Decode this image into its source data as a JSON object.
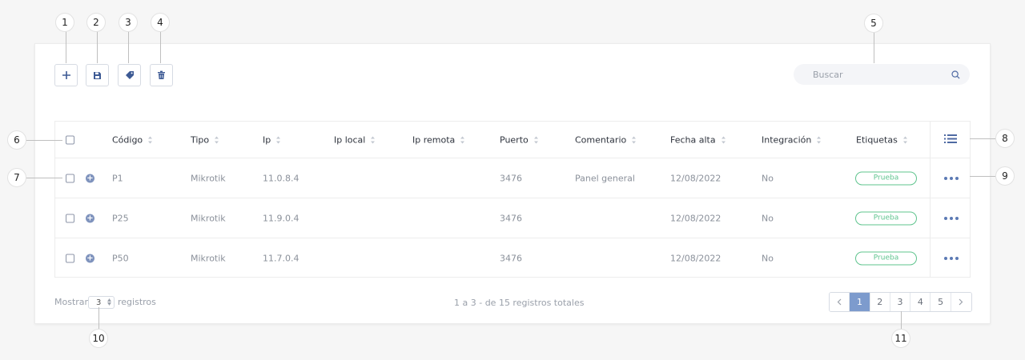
{
  "callouts": [
    "1",
    "2",
    "3",
    "4",
    "5",
    "6",
    "7",
    "8",
    "9",
    "10",
    "11"
  ],
  "toolbar": {
    "add_icon": "plus-icon",
    "save_icon": "floppy-disk-icon",
    "tag_icon": "tag-icon",
    "delete_icon": "trash-icon"
  },
  "search": {
    "placeholder": "Buscar",
    "icon": "search-icon"
  },
  "table": {
    "headers": [
      "Código",
      "Tipo",
      "Ip",
      "Ip local",
      "Ip remota",
      "Puerto",
      "Comentario",
      "Fecha alta",
      "Integración",
      "Etiquetas"
    ],
    "rows": [
      {
        "codigo": "P1",
        "tipo": "Mikrotik",
        "ip": "11.0.8.4",
        "ip_local": "",
        "ip_remota": "",
        "puerto": "3476",
        "comentario": "Panel general",
        "fecha_alta": "12/08/2022",
        "integracion": "No",
        "etiqueta": "Prueba"
      },
      {
        "codigo": "P25",
        "tipo": "Mikrotik",
        "ip": "11.9.0.4",
        "ip_local": "",
        "ip_remota": "",
        "puerto": "3476",
        "comentario": "",
        "fecha_alta": "12/08/2022",
        "integracion": "No",
        "etiqueta": "Prueba"
      },
      {
        "codigo": "P50",
        "tipo": "Mikrotik",
        "ip": "11.7.0.4",
        "ip_local": "",
        "ip_remota": "",
        "puerto": "3476",
        "comentario": "",
        "fecha_alta": "12/08/2022",
        "integracion": "No",
        "etiqueta": "Prueba"
      }
    ],
    "columns_icon": "list-icon",
    "row_menu_icon": "more-horizontal-icon"
  },
  "footer": {
    "show_label": "Mostrar",
    "rows_value": "3",
    "records_label": "registros",
    "summary": "1 a 3 - de 15 registros totales"
  },
  "pagination": {
    "prev_icon": "chevron-left-icon",
    "next_icon": "chevron-right-icon",
    "pages": [
      "1",
      "2",
      "3",
      "4",
      "5"
    ],
    "active": "1"
  },
  "colors": {
    "accent": "#7d9bcd",
    "tag": "#5fc48e",
    "icon": "#3d5a94"
  }
}
